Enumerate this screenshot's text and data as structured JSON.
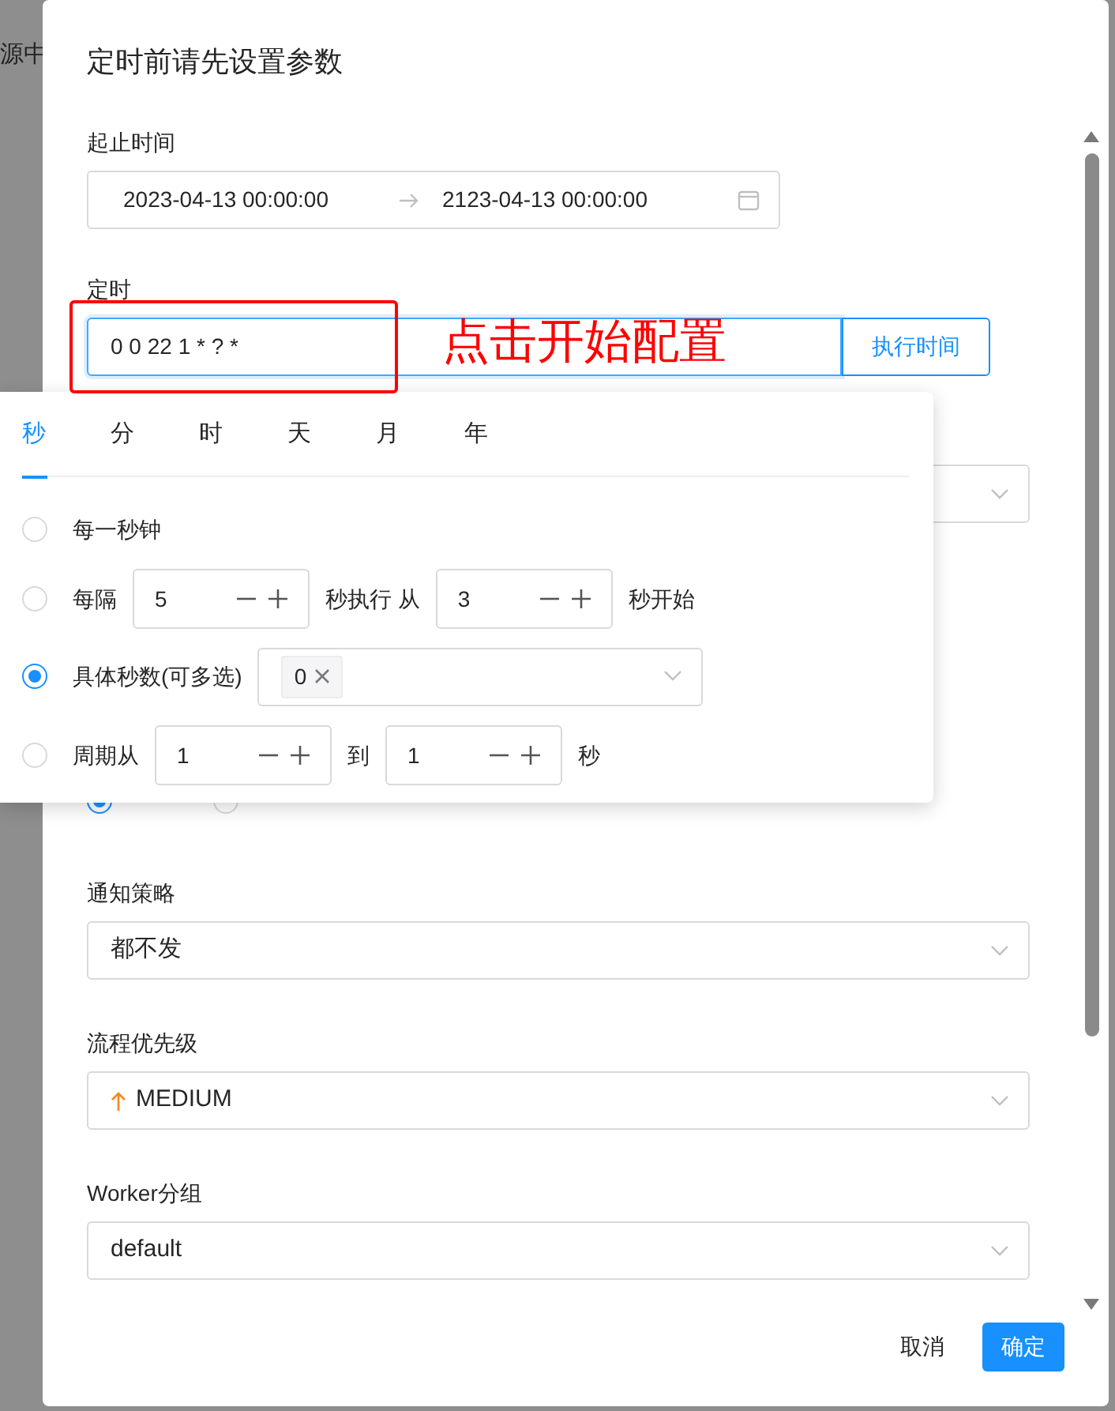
{
  "background": {
    "text": "源中"
  },
  "dialog": {
    "title": "定时前请先设置参数",
    "fields": [
      {
        "kind": "range",
        "label": "起止时间",
        "start": "2023-04-13 00:00:00",
        "end": "2123-04-13 00:00:00"
      },
      {
        "kind": "cron",
        "label": "定时",
        "value": "0 0 22 1 * ? *",
        "focused": true,
        "button": "执行时间"
      },
      {
        "kind": "covered_select"
      },
      {
        "kind": "radio",
        "options": [
          {
            "selected": true
          },
          {
            "selected": false
          }
        ]
      },
      {
        "kind": "select",
        "label": "通知策略",
        "value": "都不发"
      },
      {
        "kind": "priority",
        "label": "流程优先级",
        "value": "MEDIUM"
      },
      {
        "kind": "select",
        "label": "Worker分组",
        "value": "default"
      }
    ],
    "buttons": [
      {
        "label": "取消",
        "primary": false
      },
      {
        "label": "确定",
        "primary": true
      }
    ]
  },
  "annotation": {
    "text": "点击开始配置"
  },
  "cron_popover": {
    "tabs": [
      {
        "label": "秒",
        "selected": true
      },
      {
        "label": "分",
        "selected": false
      },
      {
        "label": "时",
        "selected": false
      },
      {
        "label": "天",
        "selected": false
      },
      {
        "label": "月",
        "selected": false
      },
      {
        "label": "年",
        "selected": false
      }
    ],
    "options": [
      {
        "selected": false,
        "parts": [
          {
            "kind": "text",
            "text": "每一秒钟"
          }
        ]
      },
      {
        "selected": false,
        "parts": [
          {
            "kind": "text",
            "text": "每隔"
          },
          {
            "kind": "number",
            "value": "5"
          },
          {
            "kind": "text",
            "text": "秒执行 从"
          },
          {
            "kind": "number",
            "value": "3"
          },
          {
            "kind": "text",
            "text": "秒开始"
          }
        ]
      },
      {
        "selected": true,
        "parts": [
          {
            "kind": "text",
            "text": "具体秒数(可多选)"
          },
          {
            "kind": "tags",
            "tags": [
              "0"
            ]
          }
        ]
      },
      {
        "selected": false,
        "parts": [
          {
            "kind": "text",
            "text": "周期从"
          },
          {
            "kind": "number",
            "value": "1"
          },
          {
            "kind": "text",
            "text": "到"
          },
          {
            "kind": "number",
            "value": "1"
          },
          {
            "kind": "text",
            "text": "秒"
          }
        ]
      }
    ]
  }
}
